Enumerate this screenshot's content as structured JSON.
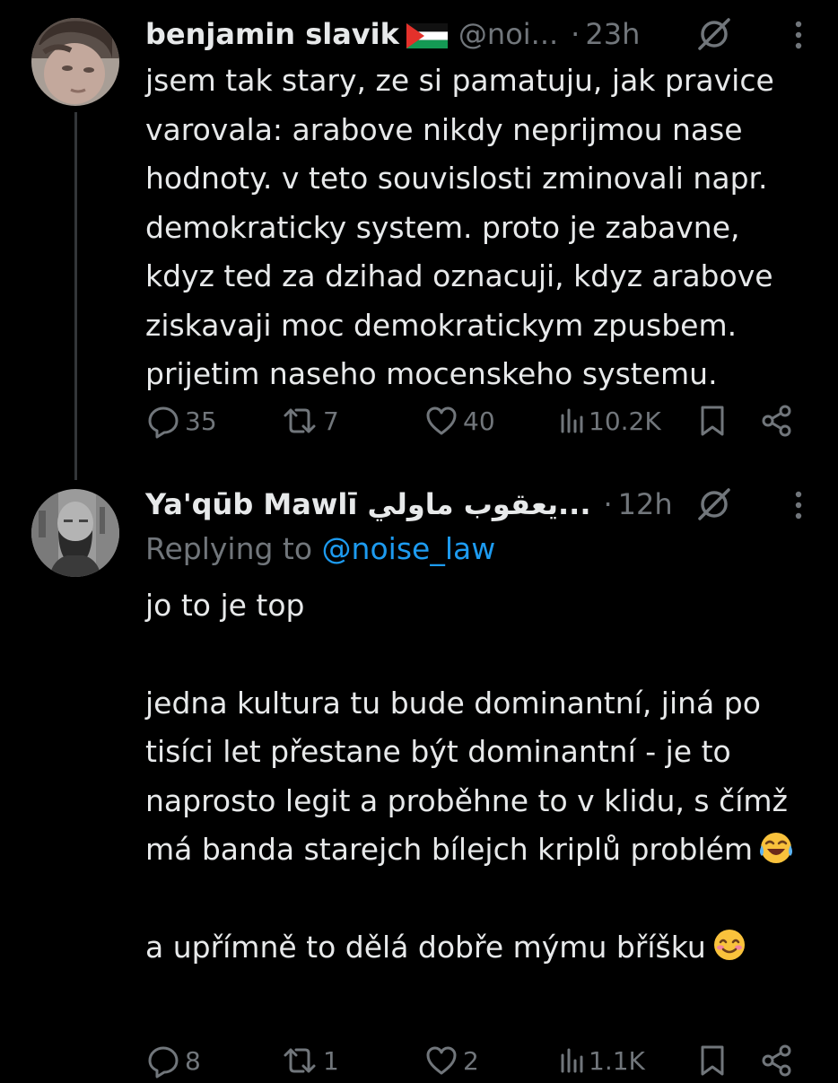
{
  "tweets": [
    {
      "display_name": "benjamin slavik",
      "flag_icon": "palestine-flag-icon",
      "handle": "@noi...",
      "dot": "·",
      "time": "23h",
      "body": "jsem tak stary, ze si pamatuju, jak pravice varovala: arabove nikdy neprijmou nase hodnoty. v teto souvislosti zminovali napr. demokraticky system. proto je zabavne, kdyz ted za dzihad oznacuji, kdyz arabove ziskavaji moc demokratickym zpusbem. prijetim naseho mocenskeho systemu.",
      "replies": "35",
      "reposts": "7",
      "likes": "40",
      "views": "10.2K"
    },
    {
      "display_name": "Ya'qūb Mawlī يعقوب ماولي...",
      "dot": "·",
      "time": "12h",
      "replying_prefix": "Replying to",
      "replying_handle": "@noise_law",
      "paragraphs": [
        "jo to je top",
        "",
        "jedna kultura tu bude dominantní, jiná po tisíci let přestane být dominantní - je to naprosto legit a proběhne to v klidu, s čímž má banda starejch bílejch kriplů problém",
        "",
        "a upřímně to dělá dobře mýmu bříšku"
      ],
      "emoji_1": "face-with-tears-of-joy",
      "emoji_2": "smiling-face-with-smiling-eyes",
      "replies": "8",
      "reposts": "1",
      "likes": "2",
      "views": "1.1K"
    }
  ],
  "colors": {
    "background": "#000000",
    "text_primary": "#e7e9ea",
    "text_secondary": "#71767b",
    "link": "#1d9bf0",
    "thread_line": "#333639"
  },
  "icons": [
    "reply-icon",
    "repost-icon",
    "like-icon",
    "views-icon",
    "bookmark-icon",
    "share-icon",
    "grok-icon",
    "more-icon"
  ]
}
